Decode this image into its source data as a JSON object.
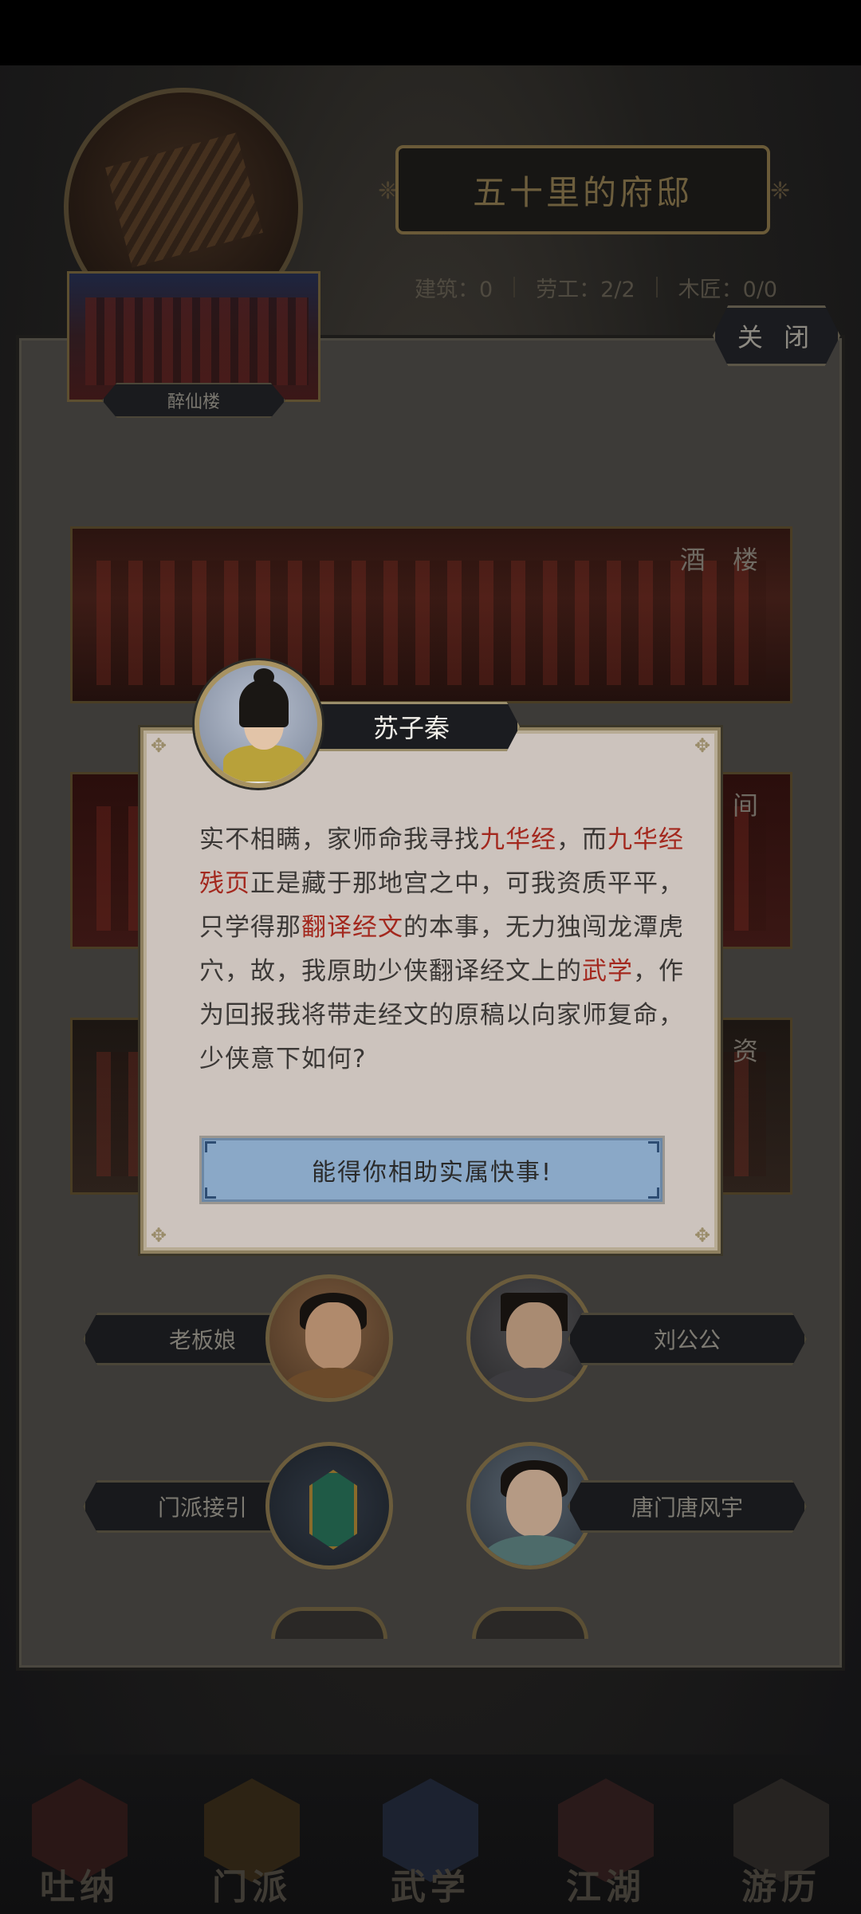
{
  "mansion": {
    "title": "五十里的府邸",
    "stats": [
      "建筑：0",
      "劳工：2/2",
      "木匠：0/0"
    ]
  },
  "close_label": "关 闭",
  "thumbnail_label": "醉仙楼",
  "locations": [
    {
      "name": "酒 楼"
    },
    {
      "name": "雅 间"
    },
    {
      "name": "谈资"
    }
  ],
  "npcs": [
    {
      "name": "老板娘"
    },
    {
      "name": "刘公公"
    },
    {
      "name": "门派接引"
    },
    {
      "name": "唐门唐风宇"
    }
  ],
  "bottom_nav": [
    {
      "label": "吐纳",
      "icon": "meditation-icon"
    },
    {
      "label": "门派",
      "icon": "sect-icon"
    },
    {
      "label": "武学",
      "icon": "martial-arts-icon"
    },
    {
      "label": "江湖",
      "icon": "jianghu-icon"
    },
    {
      "label": "游历",
      "icon": "travel-icon"
    }
  ],
  "dialog": {
    "speaker": "苏子秦",
    "segments": [
      {
        "text": "实不相瞒，家师命我寻找",
        "highlight": false
      },
      {
        "text": "九华经",
        "highlight": true
      },
      {
        "text": "，而",
        "highlight": false
      },
      {
        "text": "九华经残页",
        "highlight": true
      },
      {
        "text": "正是藏于那地宫之中，可我资质平平，只学得那",
        "highlight": false
      },
      {
        "text": "翻译经文",
        "highlight": true
      },
      {
        "text": "的本事，无力独闯龙潭虎穴，故，我原助少侠翻译经文上的",
        "highlight": false
      },
      {
        "text": "武学",
        "highlight": true
      },
      {
        "text": "，作为回报我将带走经文的原稿以向家师复命，少侠意下如何?",
        "highlight": false
      }
    ],
    "reply_button": "能得你相助实属快事!"
  },
  "colors": {
    "highlight": "#a3281e",
    "button": "#8aa8c7",
    "dialog_bg": "#ccc3bd"
  }
}
